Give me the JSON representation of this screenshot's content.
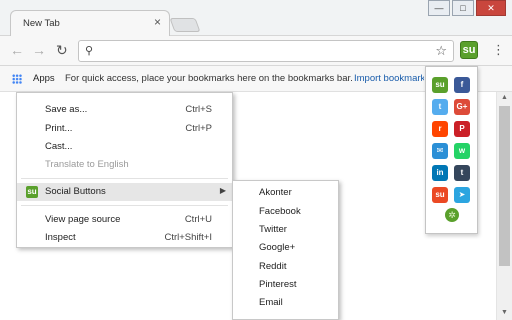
{
  "window": {
    "tab_title": "New Tab",
    "tab_close": "×",
    "minimize": "—",
    "maximize": "□",
    "close": "✕"
  },
  "toolbar": {
    "back": "←",
    "forward": "→",
    "reload": "C",
    "omnibox_value": "",
    "search_icon": "search-icon",
    "bookmark_icon": "star-icon",
    "extension_label": "su",
    "menu_icon": "⋮"
  },
  "bookmarks_bar": {
    "apps_label": "Apps",
    "hint": "For quick access, place your bookmarks here on the bookmarks bar.",
    "import_link": "Import bookmarks"
  },
  "context_menu": {
    "save_as": {
      "label": "Save as...",
      "shortcut": "Ctrl+S"
    },
    "print": {
      "label": "Print...",
      "shortcut": "Ctrl+P"
    },
    "cast": {
      "label": "Cast..."
    },
    "translate": {
      "label": "Translate to English"
    },
    "social": {
      "label": "Social Buttons",
      "icon": "su"
    },
    "view_source": {
      "label": "View page source",
      "shortcut": "Ctrl+U"
    },
    "inspect": {
      "label": "Inspect",
      "shortcut": "Ctrl+Shift+I"
    }
  },
  "submenu": {
    "items": [
      "Akonter",
      "Facebook",
      "Twitter",
      "Google+",
      "Reddit",
      "Pinterest",
      "Email"
    ]
  },
  "share_popup": {
    "buttons": [
      {
        "name": "stumbleupon",
        "glyph": "su",
        "color": "#5aa02c"
      },
      {
        "name": "facebook",
        "glyph": "f",
        "color": "#3b5998"
      },
      {
        "name": "twitter",
        "glyph": "t",
        "color": "#55acee"
      },
      {
        "name": "google-plus",
        "glyph": "G+",
        "color": "#dd4b39"
      },
      {
        "name": "reddit",
        "glyph": "r",
        "color": "#ff4500"
      },
      {
        "name": "pinterest",
        "glyph": "P",
        "color": "#cb2027"
      },
      {
        "name": "email",
        "glyph": "✉",
        "color": "#2b8fd6"
      },
      {
        "name": "whatsapp",
        "glyph": "w",
        "color": "#25d366"
      },
      {
        "name": "linkedin",
        "glyph": "in",
        "color": "#0077b5"
      },
      {
        "name": "tumblr",
        "glyph": "t",
        "color": "#35465c"
      },
      {
        "name": "stumble",
        "glyph": "su",
        "color": "#eb4924"
      },
      {
        "name": "telegram",
        "glyph": "➤",
        "color": "#2ca5e0"
      }
    ],
    "settings_glyph": "✲"
  },
  "colors": {
    "accent": "#5aa02c",
    "link": "#1a5dab"
  }
}
